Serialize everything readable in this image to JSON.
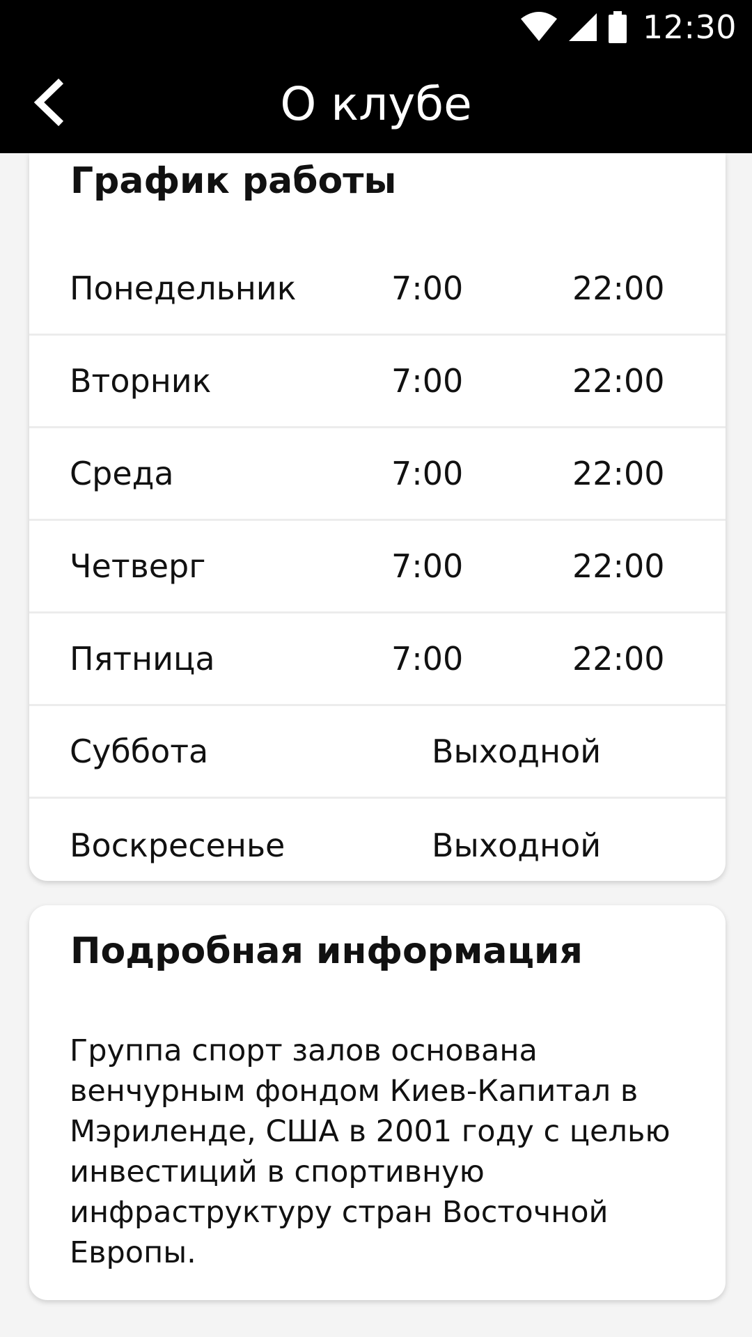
{
  "status_bar": {
    "time": "12:30",
    "icons": [
      "wifi-icon",
      "signal-icon",
      "battery-icon"
    ]
  },
  "header": {
    "back_icon": "chevron-left-icon",
    "title": "О клубе"
  },
  "schedule": {
    "title": "График работы",
    "rows": [
      {
        "day": "Понедельник",
        "open": "7:00",
        "close": "22:00"
      },
      {
        "day": "Вторник",
        "open": "7:00",
        "close": "22:00"
      },
      {
        "day": "Среда",
        "open": "7:00",
        "close": "22:00"
      },
      {
        "day": "Четверг",
        "open": "7:00",
        "close": "22:00"
      },
      {
        "day": "Пятница",
        "open": "7:00",
        "close": "22:00"
      },
      {
        "day": "Суббота",
        "dayoff": "Выходной"
      },
      {
        "day": "Воскресенье",
        "dayoff": "Выходной"
      }
    ]
  },
  "info": {
    "title": "Подробная информация",
    "text": "Группа спорт залов основана венчурным фондом Киев-Капитал в Мэриленде, США в 2001 году с целью инвестиций в спортивную инфраструктуру стран Восточной Европы."
  },
  "colors": {
    "header_background": "#000000",
    "page_background": "#f4f4f4",
    "card_background": "#ffffff"
  }
}
